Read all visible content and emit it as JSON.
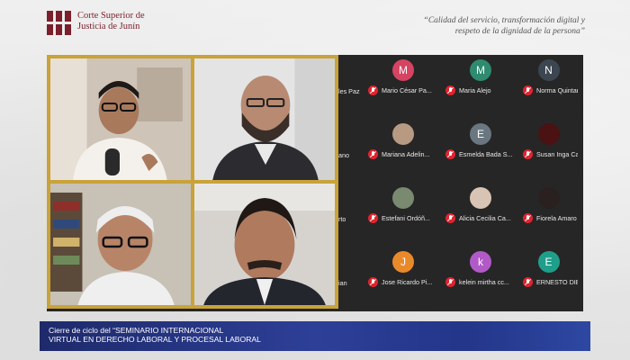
{
  "header": {
    "org_line1": "Corte Superior de",
    "org_line2": "Justicia de Junín",
    "motto_line1": "“Calidad del servicio, transformación digital y",
    "motto_line2": "respeto de la dignidad de la persona”"
  },
  "participants": [
    {
      "name": "les Paz",
      "avatar": "",
      "color": "#262626",
      "partial": true
    },
    {
      "name": "Mario César Pa...",
      "avatar": "M",
      "color": "#d64463"
    },
    {
      "name": "Maria Alejo",
      "avatar": "M",
      "color": "#2e8b6f"
    },
    {
      "name": "Norma Quintan",
      "avatar": "N",
      "color": "#3c4650"
    },
    {
      "name": "ano",
      "avatar": "",
      "color": "#262626",
      "partial": true
    },
    {
      "name": "Mariana Adelin...",
      "avatar": "photo",
      "color": "#b89a82"
    },
    {
      "name": "Esmelda Bada S...",
      "avatar": "E",
      "color": "#6a7780"
    },
    {
      "name": "Susan Inga Ca...",
      "avatar": "photo",
      "color": "#4a1212"
    },
    {
      "name": "rto",
      "avatar": "",
      "color": "#262626",
      "partial": true
    },
    {
      "name": "Estefani Ordóñ...",
      "avatar": "photo",
      "color": "#7a8a70"
    },
    {
      "name": "Alicia Cecilia Ca...",
      "avatar": "photo",
      "color": "#d8c4b4"
    },
    {
      "name": "Fiorela Amaro",
      "avatar": "photo",
      "color": "#2a2020"
    },
    {
      "name": "ian",
      "avatar": "",
      "color": "#262626",
      "partial": true
    },
    {
      "name": "Jose Ricardo Pi...",
      "avatar": "J",
      "color": "#e98a2a"
    },
    {
      "name": "kelein mirtha cc...",
      "avatar": "k",
      "color": "#b15ac7"
    },
    {
      "name": "ERNESTO DIES",
      "avatar": "E",
      "color": "#1f9e8a"
    }
  ],
  "banner": {
    "line1": "Cierre de ciclo del  “SEMINARIO INTERNACIONAL",
    "line2": "VIRTUAL EN DERECHO LABORAL Y PROCESAL LABORAL"
  },
  "colors": {
    "accent": "#7a1f2b",
    "tile_border": "#c9a23a",
    "banner": "#26378a",
    "muted_mic": "#e0242f"
  }
}
